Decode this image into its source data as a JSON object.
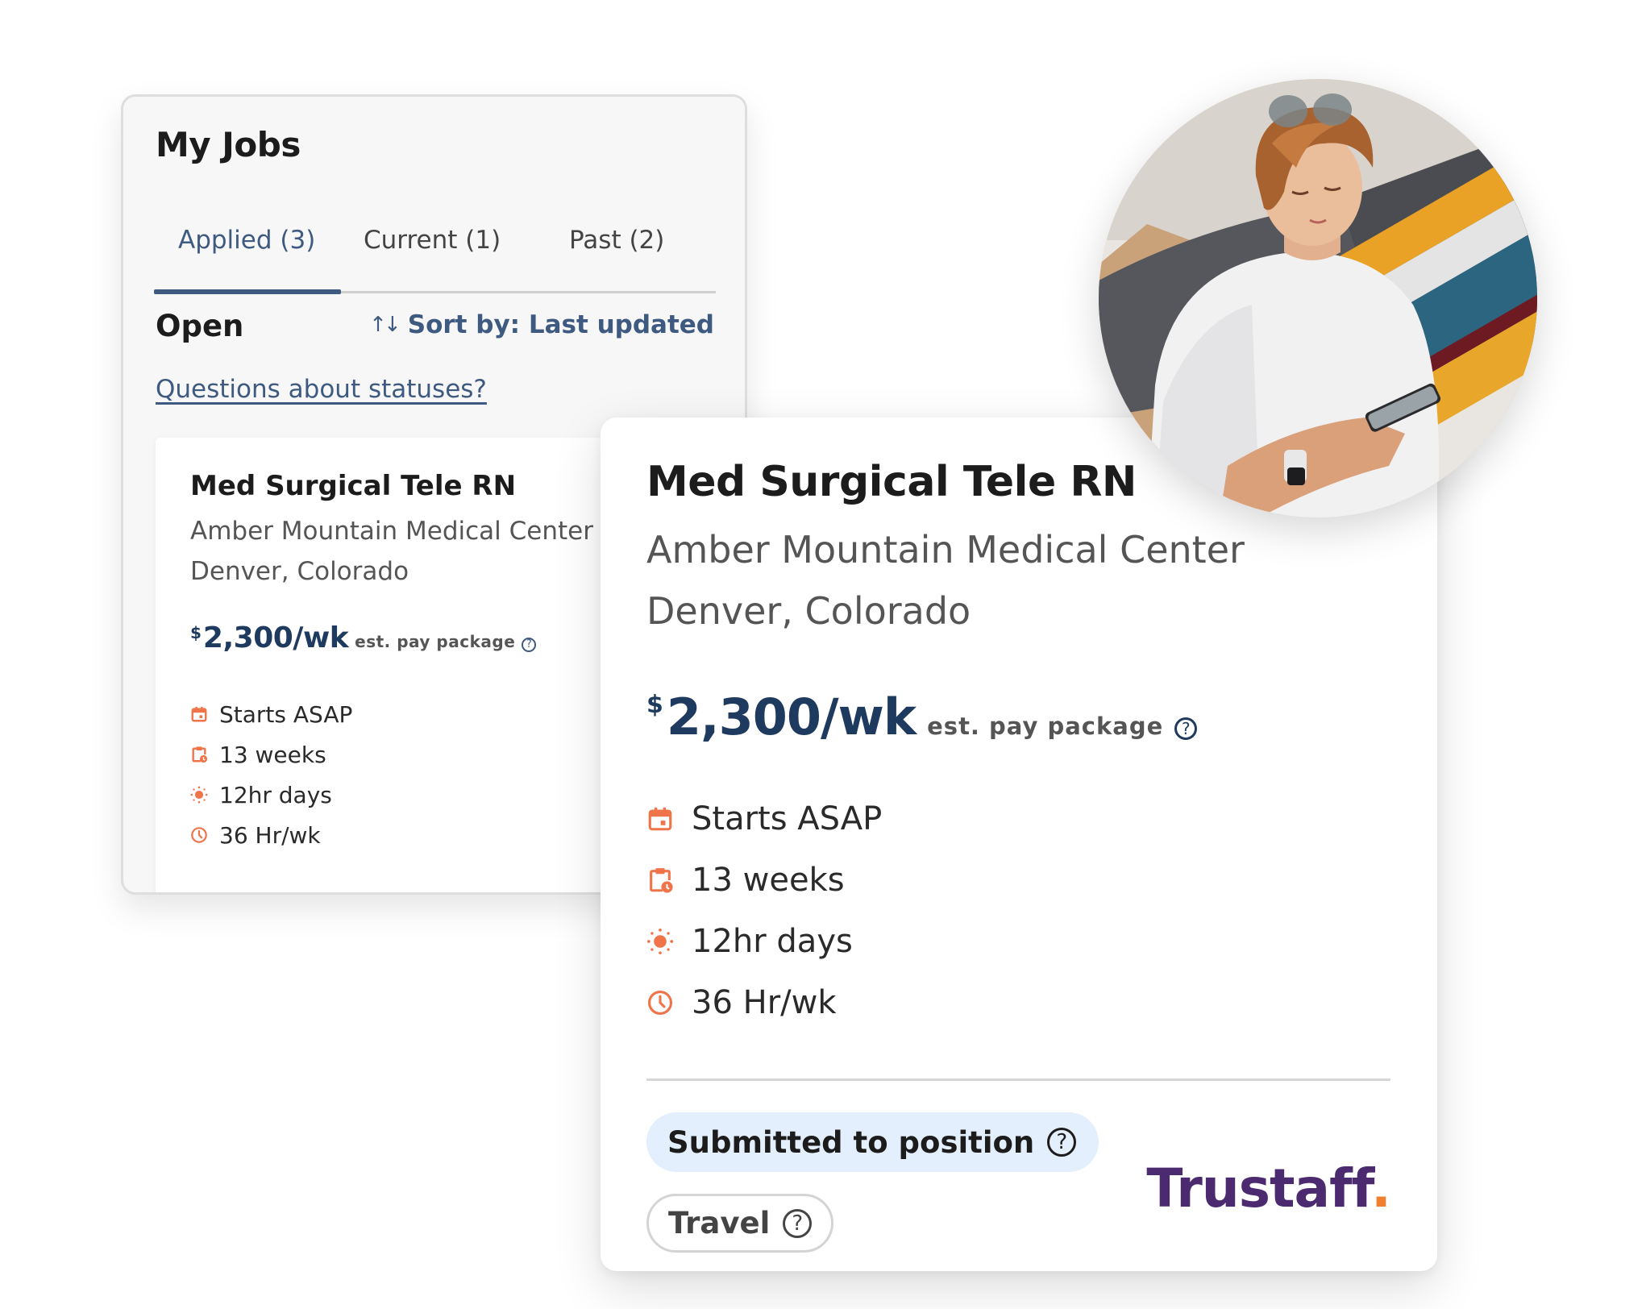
{
  "my_jobs_panel": {
    "title": "My Jobs",
    "tabs": [
      {
        "label": "Applied (3)",
        "active": true
      },
      {
        "label": "Current (1)",
        "active": false
      },
      {
        "label": "Past (2)",
        "active": false
      }
    ],
    "section_title": "Open",
    "sort_icon": "sort-arrows-icon",
    "sort_label": "Sort by: Last updated",
    "statuses_link": "Questions about statuses?",
    "job_card": {
      "title": "Med Surgical Tele RN",
      "facility": "Amber Mountain Medical Center",
      "location": "Denver, Colorado",
      "pay_currency": "$",
      "pay_amount": "2,300/wk",
      "pay_note": "est. pay package",
      "help_icon": "?",
      "details": [
        {
          "icon": "calendar-icon",
          "text": "Starts ASAP"
        },
        {
          "icon": "clipboard-clock-icon",
          "text": "13 weeks"
        },
        {
          "icon": "sun-icon",
          "text": "12hr days"
        },
        {
          "icon": "clock-icon",
          "text": "36 Hr/wk"
        }
      ]
    }
  },
  "job_detail_card": {
    "title": "Med Surgical Tele RN",
    "facility": "Amber Mountain Medical Center",
    "location": "Denver, Colorado",
    "pay_currency": "$",
    "pay_amount": "2,300/wk",
    "pay_note": "est. pay package",
    "help_icon": "?",
    "details": [
      {
        "icon": "calendar-icon",
        "text": "Starts ASAP"
      },
      {
        "icon": "clipboard-clock-icon",
        "text": "13 weeks"
      },
      {
        "icon": "sun-icon",
        "text": "12hr days"
      },
      {
        "icon": "clock-icon",
        "text": "36 Hr/wk"
      }
    ],
    "status_badge": "Submitted to position",
    "type_badge": "Travel",
    "brand_logo": {
      "text": "Trustaff",
      "dot": "."
    }
  },
  "photo": {
    "alt": "Woman in white sweater looking at phone on couch"
  },
  "colors": {
    "accent_blue": "#3e5a80",
    "pay_navy": "#1f3a5f",
    "icon_orange": "#f0744a",
    "status_badge_bg": "#e3effc",
    "brand_purple": "#4b2a70",
    "brand_orange": "#f07f2f"
  }
}
